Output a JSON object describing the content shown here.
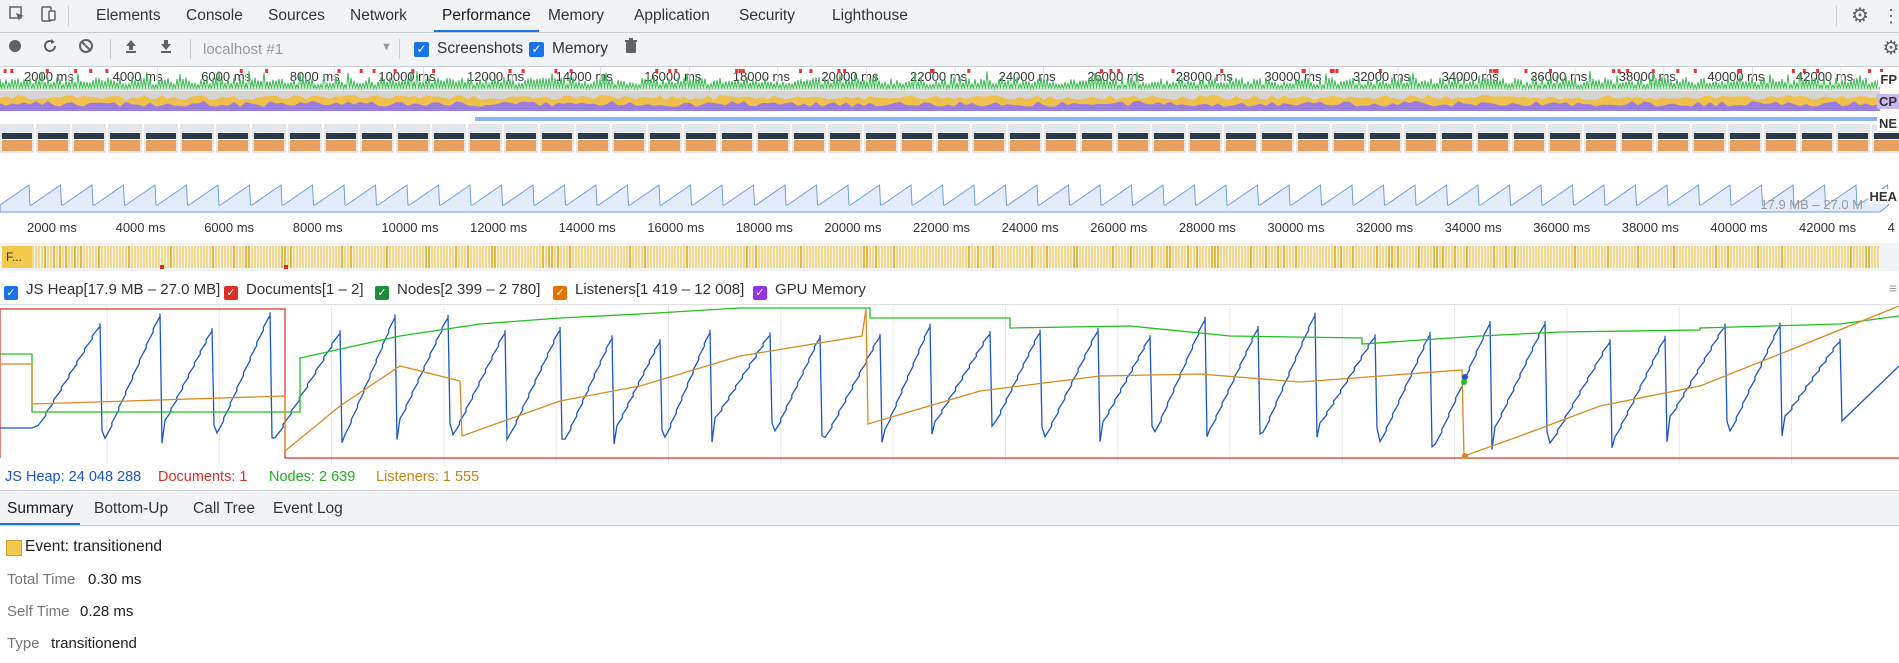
{
  "tabs": [
    "Elements",
    "Console",
    "Sources",
    "Network",
    "Performance",
    "Memory",
    "Application",
    "Security",
    "Lighthouse"
  ],
  "active_tab": "Performance",
  "toolbar": {
    "target": "localhost #1",
    "screenshots_label": "Screenshots",
    "screenshots_checked": true,
    "memory_label": "Memory",
    "memory_checked": true
  },
  "overview": {
    "ruler_top": [
      "2000 ms",
      "4000 ms",
      "6000 ms",
      "8000 ms",
      "10000 ms",
      "12000 ms",
      "14000 ms",
      "16000 ms",
      "18000 ms",
      "20000 ms",
      "22000 ms",
      "24000 ms",
      "26000 ms",
      "28000 ms",
      "30000 ms",
      "32000 ms",
      "34000 ms",
      "36000 ms",
      "38000 ms",
      "40000 ms",
      "42000 ms"
    ],
    "ruler_bottom": [
      "2000 ms",
      "4000 ms",
      "6000 ms",
      "8000 ms",
      "10000 ms",
      "12000 ms",
      "14000 ms",
      "16000 ms",
      "18000 ms",
      "20000 ms",
      "22000 ms",
      "24000 ms",
      "26000 ms",
      "28000 ms",
      "30000 ms",
      "32000 ms",
      "34000 ms",
      "36000 ms",
      "38000 ms",
      "40000 ms",
      "42000 ms",
      "4"
    ],
    "track_labels": {
      "fps": "FP",
      "cpu": "CP",
      "net": "NE",
      "heap": "HEA"
    },
    "heap_range_text": "17.9 MB – 27.0 M",
    "frames_label": "F..."
  },
  "legend": [
    {
      "label": "JS Heap[17.9 MB – 27.0 MB]",
      "color": "#1a73e8",
      "checked": true
    },
    {
      "label": "Documents[1 – 2]",
      "color": "#d93025",
      "checked": true
    },
    {
      "label": "Nodes[2 399 – 2 780]",
      "color": "#1e8e3e",
      "checked": true
    },
    {
      "label": "Listeners[1 419 – 12 008]",
      "color": "#e37400",
      "checked": true
    },
    {
      "label": "GPU Memory",
      "color": "#9334e6",
      "checked": true
    }
  ],
  "counter_values": {
    "heap": "JS Heap: 24 048 288",
    "documents": "Documents: 1",
    "nodes": "Nodes: 2 639",
    "listeners": "Listeners: 1 555"
  },
  "bottom_tabs": [
    "Summary",
    "Bottom-Up",
    "Call Tree",
    "Event Log"
  ],
  "active_bottom_tab": "Summary",
  "summary": {
    "event_title": "Event: transitionend",
    "event_color": "#f2c94c",
    "rows": [
      {
        "key": "Total Time",
        "value": "0.30 ms"
      },
      {
        "key": "Self Time",
        "value": "0.28 ms"
      },
      {
        "key": "Type",
        "value": "transitionend"
      }
    ]
  },
  "colors": {
    "heap": "#1a56c8",
    "documents": "#d93025",
    "nodes": "#20c020",
    "listeners": "#d98a1e",
    "accent": "#1a73e8"
  }
}
